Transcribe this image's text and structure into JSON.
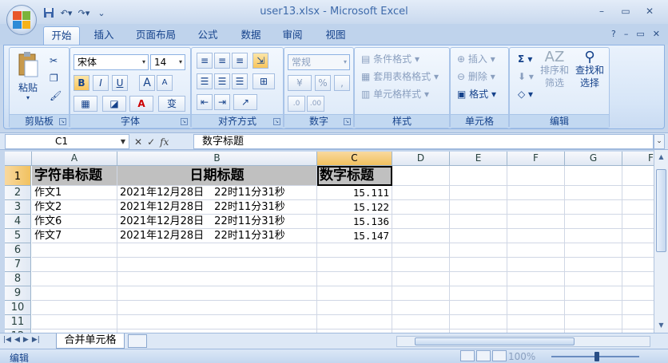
{
  "window": {
    "title": "user13.xlsx - Microsoft Excel",
    "controls": [
      "–",
      "▭",
      "✕"
    ],
    "ribbon_controls": [
      "?",
      "–",
      "▭",
      "✕"
    ]
  },
  "tabs": [
    "开始",
    "插入",
    "页面布局",
    "公式",
    "数据",
    "审阅",
    "视图"
  ],
  "ribbon": {
    "clipboard": {
      "label": "剪贴板",
      "paste": "粘贴"
    },
    "font": {
      "label": "字体",
      "name": "宋体",
      "size": "14",
      "bold": "B",
      "italic": "I",
      "underline": "U",
      "grow": "A",
      "shrink": "A"
    },
    "alignment": {
      "label": "对齐方式"
    },
    "number": {
      "label": "数字",
      "format": "常规",
      "percent": "%",
      "comma": ","
    },
    "styles": {
      "label": "样式",
      "conditional": "条件格式",
      "table": "套用表格格式",
      "cell_styles": "单元格样式"
    },
    "cells": {
      "label": "单元格",
      "insert": "插入",
      "delete": "删除",
      "format": "格式"
    },
    "editing": {
      "label": "编辑",
      "sum": "Σ",
      "sort": "排序和",
      "sort2": "筛选",
      "find": "查找和",
      "find2": "选择"
    }
  },
  "formula_bar": {
    "name_box": "C1",
    "fx": "fx",
    "content": "数字标题"
  },
  "columns": [
    "A",
    "B",
    "C",
    "D",
    "E",
    "F",
    "G",
    "F"
  ],
  "rows": [
    "1",
    "2",
    "3",
    "4",
    "5",
    "6",
    "7",
    "8",
    "9",
    "10",
    "11",
    "12"
  ],
  "cells": {
    "A1": "字符串标题",
    "B1": "日期标题",
    "C1": "数字标题",
    "A2": "作文1",
    "B2": "2021年12月28日　22时11分31秒",
    "C2": "15.111",
    "A3": "作文2",
    "B3": "2021年12月28日　22时11分31秒",
    "C3": "15.122",
    "A4": "作文6",
    "B4": "2021年12月28日　22时11分31秒",
    "C4": "15.136",
    "A5": "作文7",
    "B5": "2021年12月28日　22时11分31秒",
    "C5": "15.147"
  },
  "sheet_tab": "合并单元格",
  "status": {
    "mode": "编辑",
    "zoom": "100%"
  }
}
